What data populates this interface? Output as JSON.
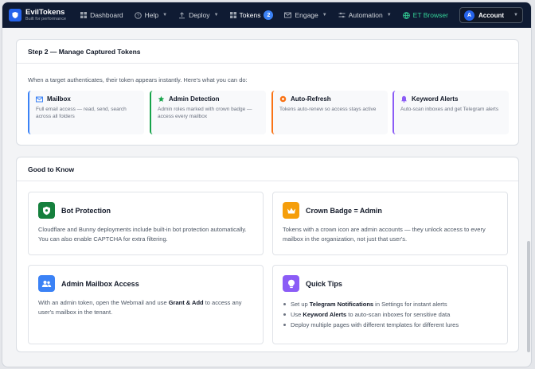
{
  "brand": {
    "name": "EvilTokens",
    "tagline": "Built for performance"
  },
  "nav": {
    "dashboard": "Dashboard",
    "help": "Help",
    "deploy": "Deploy",
    "tokens": "Tokens",
    "tokens_count": "2",
    "engage": "Engage",
    "automation": "Automation",
    "et_browser": "ET Browser",
    "account": "Account",
    "account_initial": "A"
  },
  "step2": {
    "title": "Step 2 — Manage Captured Tokens",
    "intro": "When a target authenticates, their token appears instantly. Here's what you can do:",
    "features": [
      {
        "title": "Mailbox",
        "desc": "Full email access — read, send, search across all folders",
        "color": "#3b82f6",
        "icon": "mail-icon"
      },
      {
        "title": "Admin Detection",
        "desc": "Admin roles marked with crown badge — access every mailbox",
        "color": "#16a34a",
        "icon": "star-icon"
      },
      {
        "title": "Auto-Refresh",
        "desc": "Tokens auto-renew so access stays active",
        "color": "#f97316",
        "icon": "refresh-icon"
      },
      {
        "title": "Keyword Alerts",
        "desc": "Auto-scan inboxes and get Telegram alerts",
        "color": "#8b5cf6",
        "icon": "bell-icon"
      }
    ]
  },
  "good": {
    "title": "Good to Know",
    "bot": {
      "title": "Bot Protection",
      "body": "Cloudflare and Bunny deployments include built-in bot protection automatically. You can also enable CAPTCHA for extra filtering.",
      "color": "#15803d"
    },
    "crown": {
      "title": "Crown Badge = Admin",
      "body": "Tokens with a crown icon are admin accounts — they unlock access to every mailbox in the organization, not just that user's.",
      "color": "#f59e0b"
    },
    "admin": {
      "title": "Admin Mailbox Access",
      "body_pre": "With an admin token, open the Webmail and use ",
      "body_bold": "Grant & Add",
      "body_post": " to access any user's mailbox in the tenant.",
      "color": "#3b82f6"
    },
    "tips": {
      "title": "Quick Tips",
      "color": "#8b5cf6",
      "t1_pre": "Set up ",
      "t1_bold": "Telegram Notifications",
      "t1_post": " in Settings for instant alerts",
      "t2_pre": "Use ",
      "t2_bold": "Keyword Alerts",
      "t2_post": " to auto-scan inboxes for sensitive data",
      "t3": "Deploy multiple pages with different templates for different lures"
    }
  }
}
